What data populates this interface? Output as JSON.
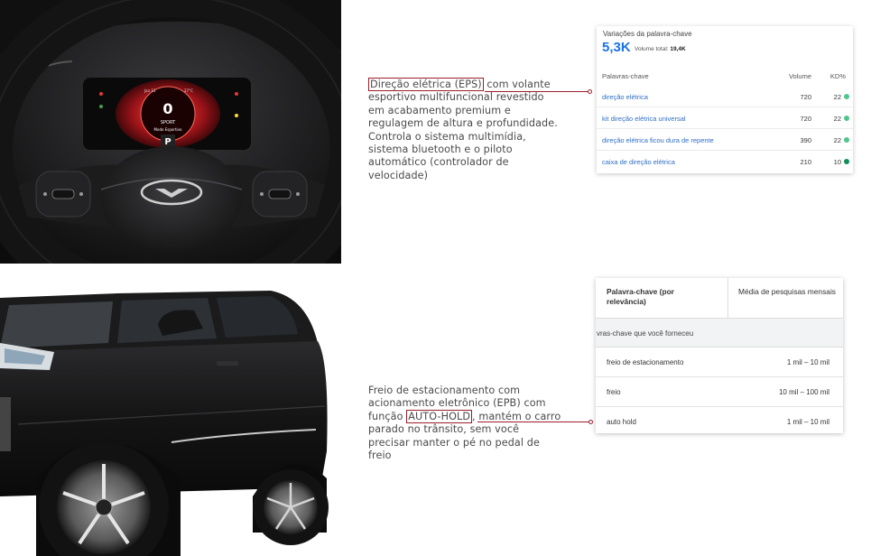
{
  "section1": {
    "highlight": "Direção elétrica (EPS)",
    "text_rest": " com volante esportivo multifuncional revestido em acabamento premium e regulagem de altura e profundidade. Controla o sistema multimídia, sistema bluetooth e o piloto automático (controlador de velocidade)"
  },
  "section2": {
    "text_before": "Freio de estacionamento com acionamento eletrônico (EPB) com função ",
    "highlight": "AUTO-HOLD",
    "text_after": ", mantém o carro parado no trânsito, sem você precisar manter o pé no pedal de freio"
  },
  "cluster": {
    "speed": "0",
    "mode": "SPORT",
    "mode_sub": "Modo Esportivo",
    "gear": "P",
    "date": "Jan 11",
    "temp": "27°C"
  },
  "card1": {
    "caption": "Variações da palavra-chave",
    "big_value": "5,3K",
    "total_label": "Volume total:",
    "total_value": "19,4K",
    "col_keyword": "Palavras-chave",
    "col_volume": "Volume",
    "col_kd": "KD%",
    "rows": [
      {
        "keyword": "direção elétrica",
        "volume": "720",
        "kd": "22",
        "dot_color": "#4fc68c"
      },
      {
        "keyword": "kit direção elétrica universal",
        "volume": "720",
        "kd": "22",
        "dot_color": "#4fc68c"
      },
      {
        "keyword": "direção elétrica ficou dura de repente",
        "volume": "390",
        "kd": "22",
        "dot_color": "#4fc68c"
      },
      {
        "keyword": "caixa de direção elétrica",
        "volume": "210",
        "kd": "10",
        "dot_color": "#0f8f5a"
      }
    ]
  },
  "card2": {
    "col_keyword": "Palavra-chave (por relevância)",
    "col_searches": "Média de pesquisas mensais",
    "section_label": "vras-chave que você forneceu",
    "rows": [
      {
        "keyword": "freio de estacionamento",
        "value": "1 mil – 10 mil"
      },
      {
        "keyword": "freio",
        "value": "10 mil – 100 mil"
      },
      {
        "keyword": "auto hold",
        "value": "1 mil – 10 mil"
      }
    ]
  },
  "colors": {
    "accent": "#9c1d2a",
    "link": "#2f6fc6",
    "big_number": "#1a73e8"
  }
}
